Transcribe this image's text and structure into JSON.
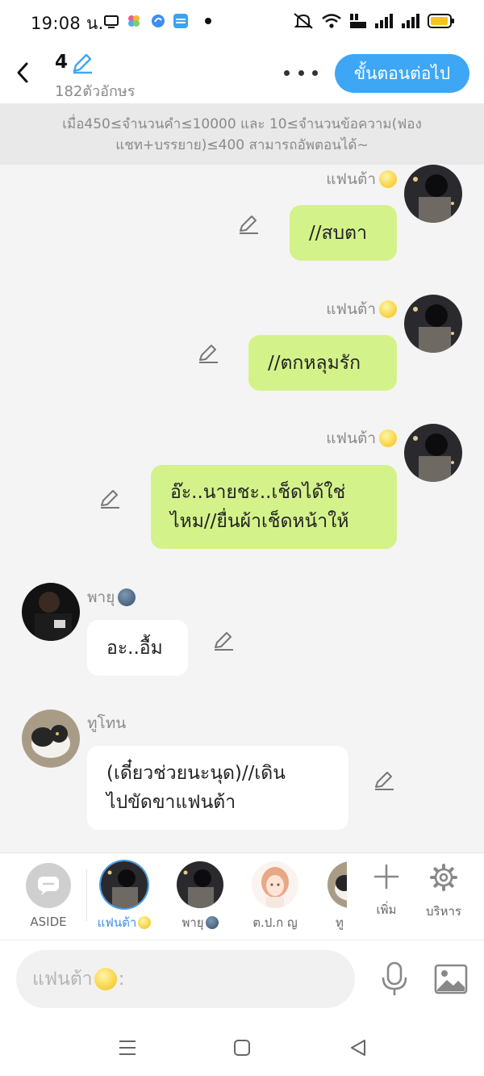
{
  "status_bar": {
    "time": "19:08 น."
  },
  "header": {
    "episode_number": "4",
    "char_count": "182ตัวอักษร",
    "next_button": "ขั้นตอนต่อไป"
  },
  "notice": {
    "line1": "เมื่อ450≤จำนวนคำ≤10000 และ 10≤จำนวนข้อความ(ฟอง",
    "line2": "แชท+บรรยาย)≤400 สามารถอัพตอนได้~"
  },
  "messages": [
    {
      "sender": "แฟนต้า",
      "text": "//สบตา",
      "side": "right"
    },
    {
      "sender": "แฟนต้า",
      "text": "//ตกหลุมรัก",
      "side": "right"
    },
    {
      "sender": "แฟนต้า",
      "line1": "อ๊ะ..นายชะ..เช็ดได้ใช่",
      "line2": "ไหม//ยื่นผ้าเช็ดหน้าให้",
      "side": "right"
    },
    {
      "sender": "พายุ",
      "text": "อะ..อื้ม",
      "side": "left"
    },
    {
      "sender": "ทูโทน",
      "line1": "(เดี๋ยวช่วยนะนุด)//เดิน",
      "line2": "ไปขัดขาแฟนต้า",
      "side": "left"
    }
  ],
  "characters": {
    "aside_label": "ASIDE",
    "items": [
      {
        "name": "แฟนต้า",
        "selected": true
      },
      {
        "name": "พายุ",
        "selected": false
      },
      {
        "name": "ต.ป.ก ญ",
        "selected": false
      },
      {
        "name": "ทู",
        "selected": false
      }
    ],
    "add_label": "เพิ่ม",
    "manage_label": "บริหาร"
  },
  "input": {
    "placeholder_name": "แฟนต้า",
    "placeholder_suffix": ":"
  },
  "colors": {
    "accent": "#3ea7f5",
    "my_bubble": "#d4f28a",
    "their_bubble": "#ffffff"
  }
}
